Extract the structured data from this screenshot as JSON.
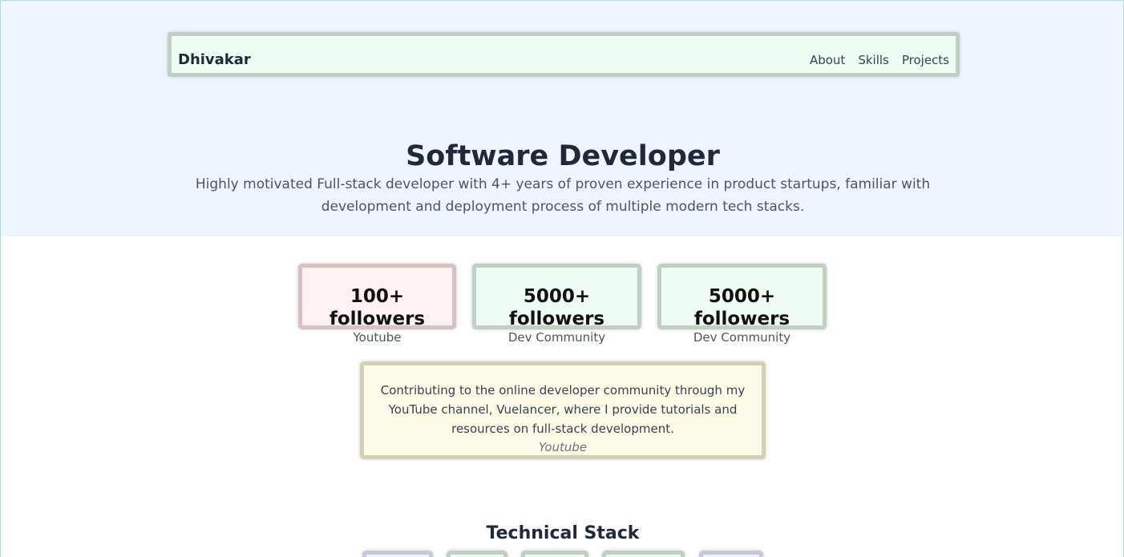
{
  "header": {
    "brand": "Dhivakar",
    "nav": [
      {
        "label": "About"
      },
      {
        "label": "Skills"
      },
      {
        "label": "Projects"
      }
    ]
  },
  "hero": {
    "title": "Software Developer",
    "description": "Highly motivated Full-stack developer with 4+ years of proven experience in product startups, familiar with development and deployment process of multiple modern tech stacks."
  },
  "stats": [
    {
      "value": "100+ followers",
      "source": "Youtube",
      "color": "#fef2f2"
    },
    {
      "value": "5000+ followers",
      "source": "Dev Community",
      "color": "#f0fdf4"
    },
    {
      "value": "5000+ followers",
      "source": "Dev Community",
      "color": "#f0fdf4"
    }
  ],
  "highlight": {
    "text": "Contributing to the online developer community through my YouTube channel, Vuelancer, where I provide tutorials and resources on full-stack development.",
    "source": "Youtube",
    "color": "#fefce8"
  },
  "stack": {
    "title": "Technical Stack"
  },
  "colors": {
    "hero_bg": "#eff6ff",
    "nav_bg": "#f0fdf4",
    "text_dark": "#1e293b"
  }
}
